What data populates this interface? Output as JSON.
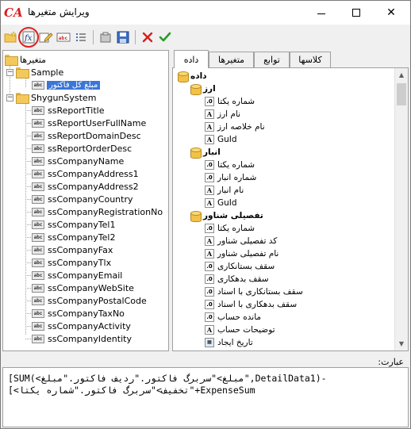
{
  "window": {
    "logo": "CA",
    "title": "ویرایش متغیرها",
    "close": "✕"
  },
  "toolbar": {
    "buttons": [
      {
        "name": "new-folder",
        "icon": "folder-new-icon"
      },
      {
        "name": "function",
        "icon": "function-icon",
        "highlighted": true
      },
      {
        "name": "edit",
        "icon": "edit-icon"
      },
      {
        "name": "rename",
        "icon": "abc-icon"
      },
      {
        "name": "properties",
        "icon": "list-icon"
      },
      {
        "name": "cut",
        "icon": "cut-icon"
      },
      {
        "name": "save",
        "icon": "save-icon"
      },
      {
        "name": "delete",
        "icon": "delete-icon"
      },
      {
        "name": "confirm",
        "icon": "check-icon"
      }
    ]
  },
  "left_tree": {
    "root": "متغیرها",
    "sample": "Sample",
    "sample_child": "مبلغ کل فاکتور",
    "system": "ShygunSystem",
    "system_items": [
      "ssReportTitle",
      "ssReportUserFullName",
      "ssReportDomainDesc",
      "ssReportOrderDesc",
      "ssCompanyName",
      "ssCompanyAddress1",
      "ssCompanyAddress2",
      "ssCompanyCountry",
      "ssCompanyRegistrationNo",
      "ssCompanyTel1",
      "ssCompanyTel2",
      "ssCompanyFax",
      "ssCompanyTlx",
      "ssCompanyEmail",
      "ssCompanyWebSite",
      "ssCompanyPostalCode",
      "ssCompanyTaxNo",
      "ssCompanyActivity",
      "ssCompanyIdentity"
    ],
    "item_icon": "abc"
  },
  "tabs": [
    {
      "label": "کلاسها",
      "active": false
    },
    {
      "label": "توابع",
      "active": false
    },
    {
      "label": "متغیرها",
      "active": false
    },
    {
      "label": "داده",
      "active": true
    }
  ],
  "right_tree": {
    "root": "داده",
    "groups": [
      {
        "label": "ارز",
        "items": [
          {
            "label": "شماره یکتا",
            "type": "num"
          },
          {
            "label": "نام ارز",
            "type": "text"
          },
          {
            "label": "نام خلاصه ارز",
            "type": "text"
          },
          {
            "label": "GuId",
            "type": "text"
          }
        ]
      },
      {
        "label": "انبار",
        "items": [
          {
            "label": "شماره یکتا",
            "type": "num"
          },
          {
            "label": "شماره انبار",
            "type": "num"
          },
          {
            "label": "نام انبار",
            "type": "text"
          },
          {
            "label": "GuId",
            "type": "text"
          }
        ]
      },
      {
        "label": "تفصیلی شناور",
        "items": [
          {
            "label": "شماره یکتا",
            "type": "num"
          },
          {
            "label": "کد تفصیلی شناور",
            "type": "text"
          },
          {
            "label": "نام تفصیلی شناور",
            "type": "text"
          },
          {
            "label": "سقف بستانکاری",
            "type": "num"
          },
          {
            "label": "سقف بدهکاری",
            "type": "num"
          },
          {
            "label": "سقف بستانکاری با اسناد",
            "type": "num"
          },
          {
            "label": "سقف بدهکاری با اسناد",
            "type": "num"
          },
          {
            "label": "مانده حساب",
            "type": "num"
          },
          {
            "label": "توضیحات حساب",
            "type": "text"
          },
          {
            "label": "تاریخ ایجاد",
            "type": "date"
          }
        ]
      }
    ],
    "icon_glyphs": {
      "num": ".0",
      "text": "A",
      "date": "▦"
    }
  },
  "expression": {
    "label": "عبارت:",
    "lines": [
      "[SUM(<مبلغ>\"سربرگ فاکتور.\"ردیف فاکتور.\"مبلغ\",DetailData1)-",
      "[<تخفیف>\"سربرگ فاکتور.\"شماره یکتا\"+ExpenseSum"
    ]
  },
  "colors": {
    "selection": "#3a76d8",
    "highlight_ring": "#e02020",
    "logo": "#d81e1e"
  }
}
